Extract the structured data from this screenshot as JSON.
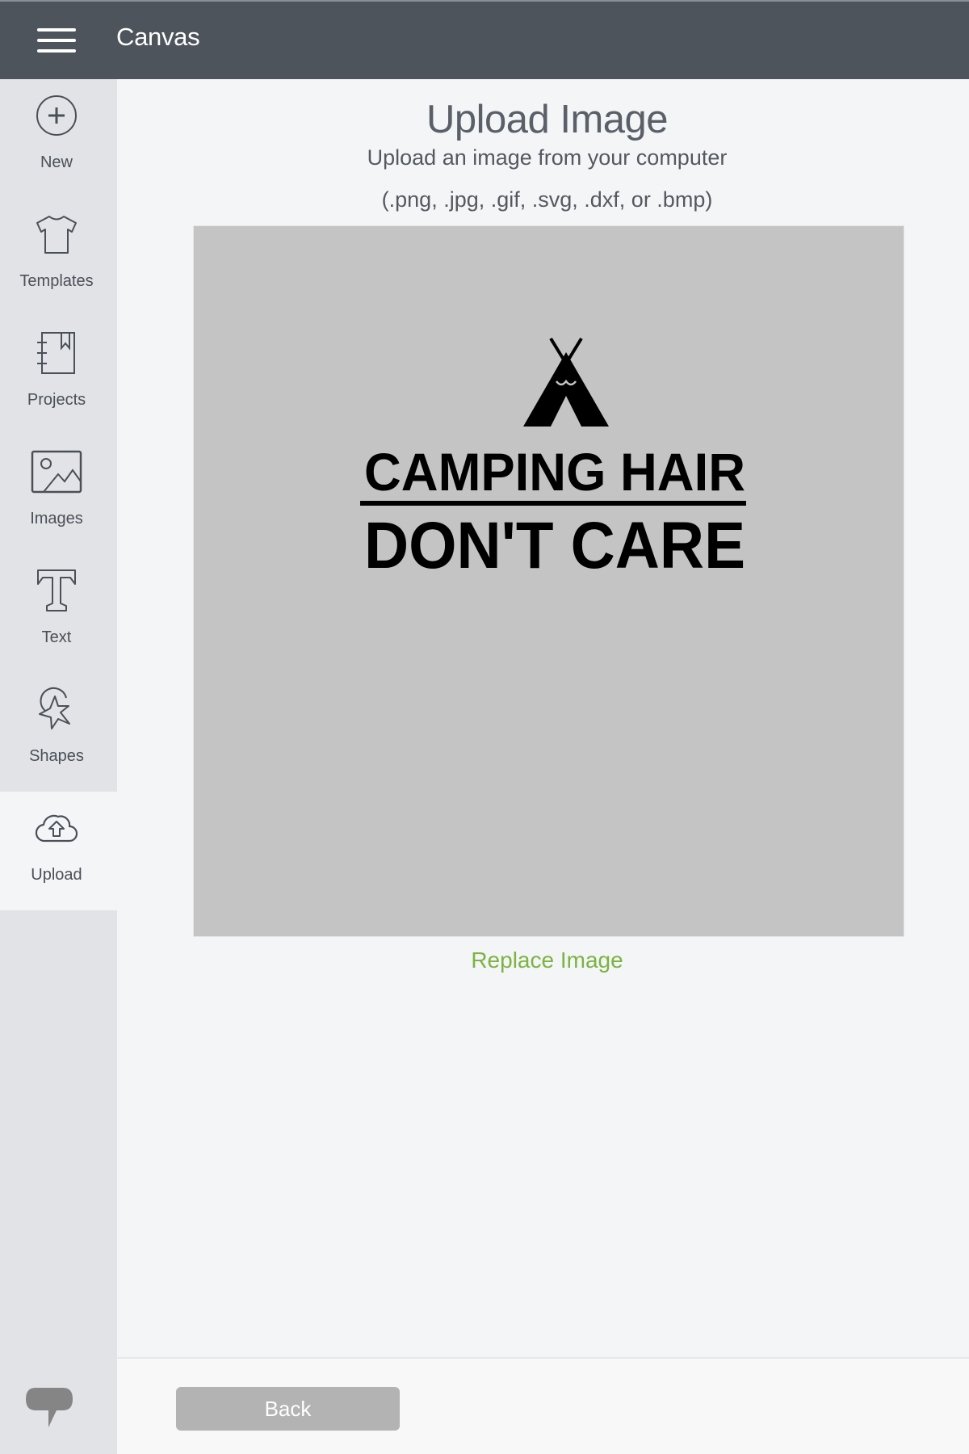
{
  "header": {
    "menu_icon": "hamburger-menu-icon",
    "title": "Canvas"
  },
  "sidebar": {
    "items": [
      {
        "id": "new",
        "label": "New",
        "icon": "plus-circle-icon",
        "active": false
      },
      {
        "id": "templates",
        "label": "Templates",
        "icon": "tshirt-icon",
        "active": false
      },
      {
        "id": "projects",
        "label": "Projects",
        "icon": "notebook-icon",
        "active": false
      },
      {
        "id": "images",
        "label": "Images",
        "icon": "image-icon",
        "active": false
      },
      {
        "id": "text",
        "label": "Text",
        "icon": "text-t-icon",
        "active": false
      },
      {
        "id": "shapes",
        "label": "Shapes",
        "icon": "shapes-icon",
        "active": false
      },
      {
        "id": "upload",
        "label": "Upload",
        "icon": "cloud-upload-icon",
        "active": true
      }
    ],
    "chat_icon": "chat-bubble-icon"
  },
  "main": {
    "title": "Upload Image",
    "subtitle": "Upload an image from your computer",
    "formats": "(.png, .jpg, .gif, .svg, .dxf, or .bmp)",
    "preview": {
      "line1": "CAMPING HAIR",
      "line2": "DON'T CARE",
      "graphic": "teepee"
    },
    "replace_label": "Replace Image"
  },
  "footer": {
    "back_label": "Back"
  },
  "colors": {
    "header_bg": "#4d545c",
    "sidebar_bg": "#e2e3e6",
    "page_bg": "#f4f5f7",
    "preview_bg": "#c4c4c4",
    "accent_green": "#7cb342",
    "back_button_bg": "#b3b3b3"
  }
}
